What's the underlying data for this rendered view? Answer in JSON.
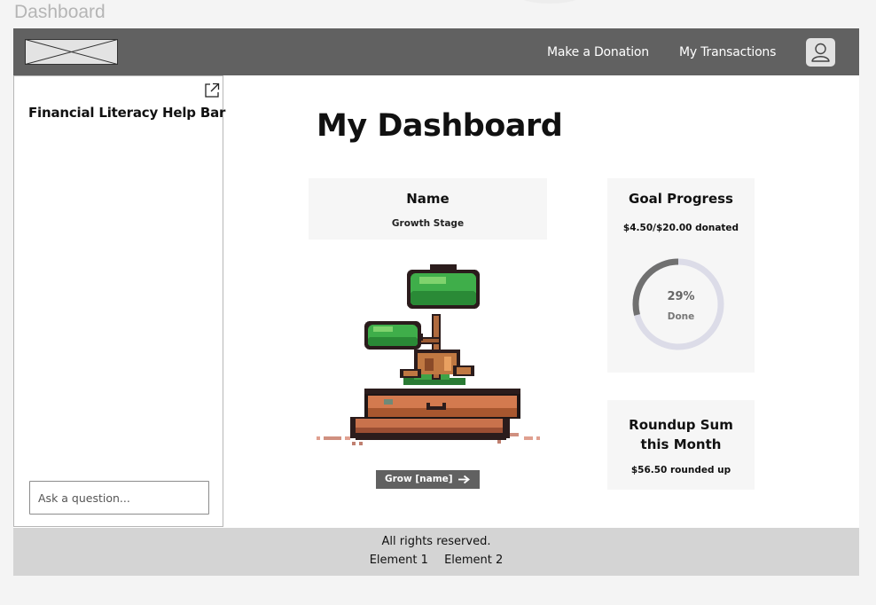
{
  "frame": {
    "title": "Dashboard"
  },
  "navbar": {
    "logo_icon": "image-placeholder-icon",
    "links": [
      "Make a Donation",
      "My Transactions"
    ],
    "avatar_icon": "user-icon",
    "background": "#616161"
  },
  "sidebar": {
    "title": "Financial Literacy Help Bar",
    "open_icon": "external-link-icon",
    "ask_placeholder": "Ask a question..."
  },
  "main": {
    "title": "My Dashboard",
    "plant": {
      "name": "Name",
      "stage": "Growth Stage",
      "image_icon": "bonsai-tree-icon",
      "grow_button": "Grow [name]",
      "grow_icon": "arrow-right-icon"
    },
    "goal": {
      "title": "Goal Progress",
      "donated": "$4.50/$20.00 donated",
      "percent_label": "29%",
      "done_label": "Done",
      "progress": 0.29,
      "ring_color": "#707070",
      "track_color": "#dcdce8"
    },
    "roundup": {
      "title_line1": "Roundup Sum",
      "title_line2": "this Month",
      "amount": "$56.50 rounded up"
    }
  },
  "footer": {
    "rights": "All rights reserved.",
    "links": [
      "Element 1",
      "Element 2"
    ]
  }
}
